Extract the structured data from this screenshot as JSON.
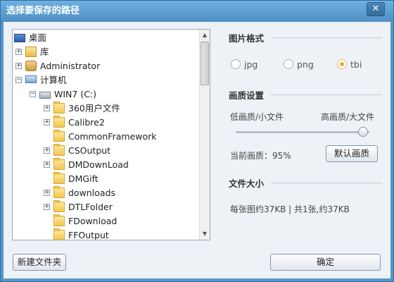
{
  "window": {
    "title": "选择要保存的路径",
    "close_glyph": "✕"
  },
  "tree": {
    "items": [
      {
        "label": "桌面",
        "icon": "desktop-icon",
        "expander": ""
      },
      {
        "label": "库",
        "icon": "library-icon",
        "expander": "+"
      },
      {
        "label": "Administrator",
        "icon": "user-icon",
        "expander": "+"
      },
      {
        "label": "计算机",
        "icon": "computer-icon",
        "expander": "−"
      },
      {
        "label": "WIN7 (C:)",
        "icon": "drive-icon",
        "expander": "−"
      },
      {
        "label": "360用户文件",
        "icon": "folder-icon",
        "expander": "+"
      },
      {
        "label": "Calibre2",
        "icon": "folder-icon",
        "expander": "+"
      },
      {
        "label": "CommonFramework",
        "icon": "folder-icon",
        "expander": ""
      },
      {
        "label": "CSOutput",
        "icon": "folder-icon",
        "expander": "+"
      },
      {
        "label": "DMDownLoad",
        "icon": "folder-icon",
        "expander": "+"
      },
      {
        "label": "DMGift",
        "icon": "folder-icon",
        "expander": ""
      },
      {
        "label": "downloads",
        "icon": "folder-icon",
        "expander": "+"
      },
      {
        "label": "DTLFolder",
        "icon": "folder-icon",
        "expander": "+"
      },
      {
        "label": "FDownload",
        "icon": "folder-icon",
        "expander": ""
      },
      {
        "label": "FFOutput",
        "icon": "folder-icon",
        "expander": ""
      }
    ]
  },
  "format": {
    "title": "图片格式",
    "options": [
      {
        "label": "jpg",
        "checked": false
      },
      {
        "label": "png",
        "checked": false
      },
      {
        "label": "tbi",
        "checked": true
      }
    ]
  },
  "quality": {
    "title": "画质设置",
    "low_label": "低画质/小文件",
    "high_label": "高画质/大文件",
    "current_text": "当前画质：95%",
    "value_percent": 95,
    "default_button": "默认画质"
  },
  "filesize": {
    "title": "文件大小",
    "info": "每张图约37KB | 共1张,约37KB"
  },
  "footer": {
    "new_folder_button": "新建文件夹",
    "ok_button": "确定"
  },
  "colors": {
    "accent": "#f0a540",
    "titlebar": "#5596c9"
  }
}
